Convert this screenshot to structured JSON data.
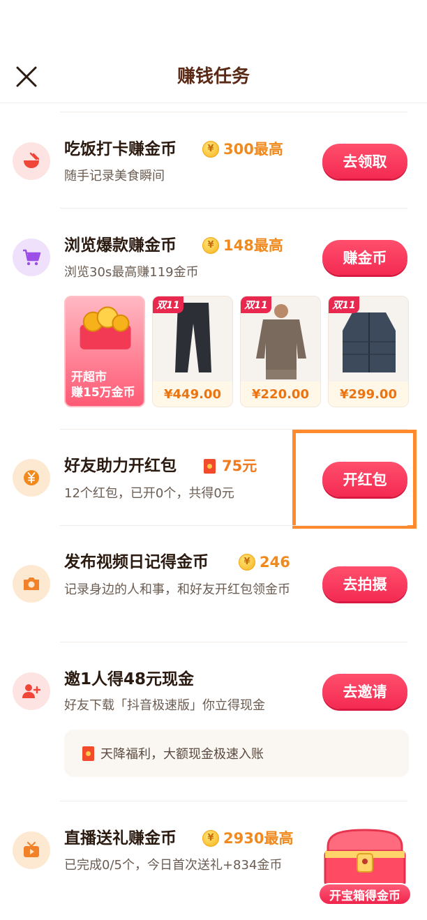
{
  "header": {
    "title": "赚钱任务",
    "close_icon": "close-icon"
  },
  "tasks": [
    {
      "title": "吃饭打卡赚金币",
      "reward": "300最高",
      "subtitle": "随手记录美食瞬间",
      "button": "去领取",
      "icon": "bowl-icon",
      "icon_bg": "#fde3e1",
      "icon_color": "#f0463a"
    },
    {
      "title": "浏览爆款赚金币",
      "reward": "148最高",
      "subtitle": "浏览30s最高赚119金币",
      "button": "赚金币",
      "icon": "cart-icon",
      "icon_bg": "#efe1fb",
      "icon_color": "#9b4fe6"
    },
    {
      "title": "好友助力开红包",
      "reward": "75元",
      "subtitle": "12个红包，已开0个，共得0元",
      "button": "开红包",
      "icon": "yuan-icon",
      "icon_bg": "#fde9d2",
      "icon_color": "#f08a1e"
    },
    {
      "title": "发布视频日记得金币",
      "reward": "246",
      "subtitle": "记录身边的人和事，和好友开红包领金币",
      "button": "去拍摄",
      "icon": "camera-icon",
      "icon_bg": "#fde9d2",
      "icon_color": "#f2822a"
    },
    {
      "title": "邀1人得48元现金",
      "reward": "",
      "subtitle": "好友下载「抖音极速版」你立得现金",
      "button": "去邀请",
      "icon": "invite-icon",
      "icon_bg": "#fde3e1",
      "icon_color": "#f0463a"
    },
    {
      "title": "直播送礼赚金币",
      "reward": "2930最高",
      "subtitle": "已完成0/5个，今日首次送礼+834金币",
      "button": "",
      "icon": "tv-icon",
      "icon_bg": "#fde9d2",
      "icon_color": "#f2822a"
    }
  ],
  "products": [
    {
      "tag": "",
      "label": "开超市\n赚15万金币",
      "price": ""
    },
    {
      "tag": "双11",
      "price": "¥449.00"
    },
    {
      "tag": "双11",
      "price": "¥220.00"
    },
    {
      "tag": "双11",
      "price": "¥299.00"
    }
  ],
  "products_super_label_1": "开超市",
  "products_super_label_2": "赚15万金币",
  "notice": {
    "text": "天降福利，大额现金极速入账"
  },
  "chest": {
    "label": "开宝箱得金币"
  },
  "coin_symbol": "¥"
}
